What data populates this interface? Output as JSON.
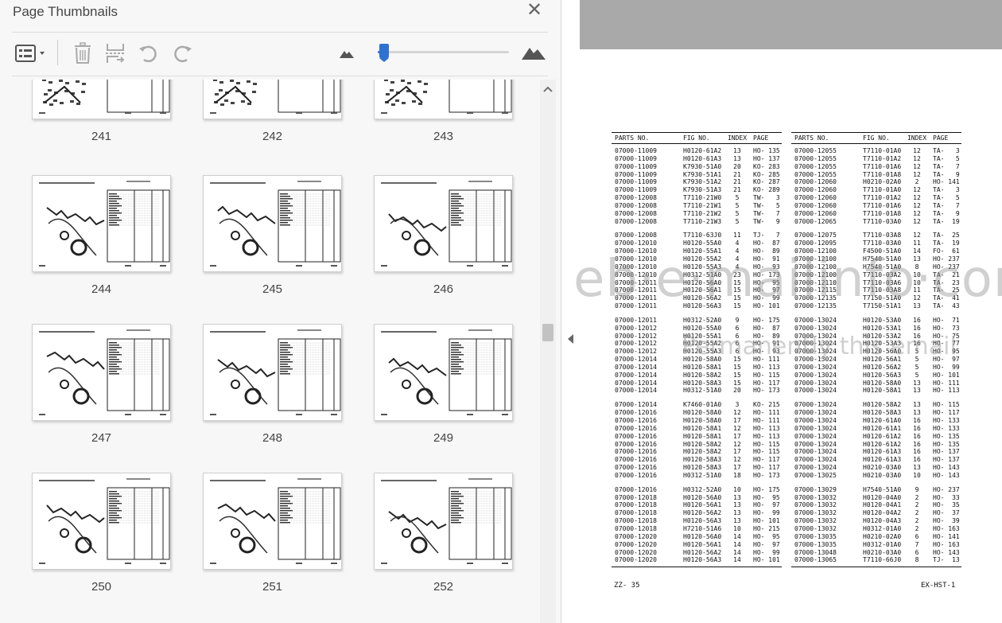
{
  "panel": {
    "title": "Page Thumbnails",
    "close_glyph": "✕",
    "zoom_level": 0.03,
    "toolbar_icons": [
      "options-icon",
      "trash-icon",
      "extract-pages-icon",
      "rotate-ccw-icon",
      "rotate-cw-icon",
      "mountain-small-icon",
      "mountain-large-icon"
    ]
  },
  "thumbnails": [
    {
      "page": "241"
    },
    {
      "page": "242"
    },
    {
      "page": "243"
    },
    {
      "page": "244"
    },
    {
      "page": "245"
    },
    {
      "page": "246"
    },
    {
      "page": "247"
    },
    {
      "page": "248"
    },
    {
      "page": "249"
    },
    {
      "page": "250"
    },
    {
      "page": "251"
    },
    {
      "page": "252"
    }
  ],
  "document": {
    "headers": [
      "PARTS NO.",
      "FIG NO.",
      "INDEX",
      "PAGE"
    ],
    "left_groups": [
      [
        [
          "07000-11009",
          "H0120-61A2",
          "13",
          "HO- 135"
        ],
        [
          "07000-11009",
          "H0120-61A3",
          "13",
          "HO- 137"
        ],
        [
          "07000-11009",
          "K7930-51A0",
          "20",
          "KO- 283"
        ],
        [
          "07000-11009",
          "K7930-51A1",
          "21",
          "KO- 285"
        ],
        [
          "07000-11009",
          "K7930-51A2",
          "21",
          "KO- 287"
        ],
        [
          "07000-11009",
          "K7930-51A3",
          "21",
          "KO- 289"
        ],
        [
          "07000-12008",
          "T7110-21W0",
          "5",
          "TW-   3"
        ],
        [
          "07000-12008",
          "T7110-21W1",
          "5",
          "TW-   5"
        ],
        [
          "07000-12008",
          "T7110-21W2",
          "5",
          "TW-   7"
        ],
        [
          "07000-12008",
          "T7110-21W3",
          "5",
          "TW-   9"
        ]
      ],
      [
        [
          "07000-12008",
          "T7110-63J0",
          "11",
          "TJ-   7"
        ],
        [
          "07000-12010",
          "H0120-55A0",
          "4",
          "HO-  87"
        ],
        [
          "07000-12010",
          "H0120-55A1",
          "4",
          "HO-  89"
        ],
        [
          "07000-12010",
          "H0120-55A2",
          "4",
          "HO-  91"
        ],
        [
          "07000-12010",
          "H0120-55A3",
          "4",
          "HO-  93"
        ],
        [
          "07000-12010",
          "H0312-51A0",
          "23",
          "HO- 173"
        ],
        [
          "07000-12011",
          "H0120-56A0",
          "15",
          "HO-  95"
        ],
        [
          "07000-12011",
          "H0120-56A1",
          "15",
          "HO-  97"
        ],
        [
          "07000-12011",
          "H0120-56A2",
          "15",
          "HO-  99"
        ],
        [
          "07000-12011",
          "H0120-56A3",
          "15",
          "HO- 101"
        ]
      ],
      [
        [
          "07000-12011",
          "H0312-52A0",
          "9",
          "HO- 175"
        ],
        [
          "07000-12012",
          "H0120-55A0",
          "6",
          "HO-  87"
        ],
        [
          "07000-12012",
          "H0120-55A1",
          "6",
          "HO-  89"
        ],
        [
          "07000-12012",
          "H0120-55A2",
          "6",
          "HO-  91"
        ],
        [
          "07000-12012",
          "H0120-55A3",
          "6",
          "HO-  93"
        ],
        [
          "07000-12014",
          "H0120-58A0",
          "15",
          "HO- 111"
        ],
        [
          "07000-12014",
          "H0120-58A1",
          "15",
          "HO- 113"
        ],
        [
          "07000-12014",
          "H0120-58A2",
          "15",
          "HO- 115"
        ],
        [
          "07000-12014",
          "H0120-58A3",
          "15",
          "HO- 117"
        ],
        [
          "07000-12014",
          "H0312-51A0",
          "20",
          "HO- 173"
        ]
      ],
      [
        [
          "07000-12014",
          "K7460-01A0",
          "3",
          "KO- 215"
        ],
        [
          "07000-12016",
          "H0120-58A0",
          "12",
          "HO- 111"
        ],
        [
          "07000-12016",
          "H0120-58A0",
          "17",
          "HO- 111"
        ],
        [
          "07000-12016",
          "H0120-58A1",
          "12",
          "HO- 113"
        ],
        [
          "07000-12016",
          "H0120-58A1",
          "17",
          "HO- 113"
        ],
        [
          "07000-12016",
          "H0120-58A2",
          "12",
          "HO- 115"
        ],
        [
          "07000-12016",
          "H0120-58A2",
          "17",
          "HO- 115"
        ],
        [
          "07000-12016",
          "H0120-58A3",
          "12",
          "HO- 117"
        ],
        [
          "07000-12016",
          "H0120-58A3",
          "17",
          "HO- 117"
        ],
        [
          "07000-12016",
          "H0312-51A0",
          "18",
          "HO- 173"
        ]
      ],
      [
        [
          "07000-12016",
          "H0312-52A0",
          "10",
          "HO- 175"
        ],
        [
          "07000-12018",
          "H0120-56A0",
          "13",
          "HO-  95"
        ],
        [
          "07000-12018",
          "H0120-56A1",
          "13",
          "HO-  97"
        ],
        [
          "07000-12018",
          "H0120-56A2",
          "13",
          "HO-  99"
        ],
        [
          "07000-12018",
          "H0120-56A3",
          "13",
          "HO- 101"
        ],
        [
          "07000-12018",
          "H7210-51A6",
          "10",
          "HO- 215"
        ],
        [
          "07000-12020",
          "H0120-56A0",
          "14",
          "HO-  95"
        ],
        [
          "07000-12020",
          "H0120-56A1",
          "14",
          "HO-  97"
        ],
        [
          "07000-12020",
          "H0120-56A2",
          "14",
          "HO-  99"
        ],
        [
          "07000-12020",
          "H0120-56A3",
          "14",
          "HO- 101"
        ]
      ]
    ],
    "right_groups": [
      [
        [
          "07000-12055",
          "T7110-01A0",
          "12",
          "TA-   3"
        ],
        [
          "07000-12055",
          "T7110-01A2",
          "12",
          "TA-   5"
        ],
        [
          "07000-12055",
          "T7110-01A6",
          "12",
          "TA-   7"
        ],
        [
          "07000-12055",
          "T7110-01A8",
          "12",
          "TA-   9"
        ],
        [
          "07000-12060",
          "H0210-02A0",
          "2",
          "HO- 141"
        ],
        [
          "07000-12060",
          "T7110-01A0",
          "12",
          "TA-   3"
        ],
        [
          "07000-12060",
          "T7110-01A2",
          "12",
          "TA-   5"
        ],
        [
          "07000-12060",
          "T7110-01A6",
          "12",
          "TA-   7"
        ],
        [
          "07000-12060",
          "T7110-01A8",
          "12",
          "TA-   9"
        ],
        [
          "07000-12065",
          "T7110-03A0",
          "12",
          "TA-  19"
        ]
      ],
      [
        [
          "07000-12075",
          "T7110-03A8",
          "12",
          "TA-  25"
        ],
        [
          "07000-12095",
          "T7110-03A0",
          "11",
          "TA-  19"
        ],
        [
          "07000-12100",
          "F4500-51A0",
          "14",
          "FO-  61"
        ],
        [
          "07000-12100",
          "H7540-51A0",
          "13",
          "HO- 237"
        ],
        [
          "07000-12100",
          "H7540-51A0",
          "8",
          "HO- 237"
        ],
        [
          "07000-12100",
          "T7110-03A2",
          "10",
          "TA-  21"
        ],
        [
          "07000-12110",
          "T7110-03A6",
          "10",
          "TA-  23"
        ],
        [
          "07000-12115",
          "T7110-03A8",
          "11",
          "TA-  25"
        ],
        [
          "07000-12135",
          "T7150-51A0",
          "12",
          "TA-  41"
        ],
        [
          "07000-12135",
          "T7150-51A1",
          "13",
          "TA-  43"
        ]
      ],
      [
        [
          "07000-13024",
          "H0120-53A0",
          "16",
          "HO-  71"
        ],
        [
          "07000-13024",
          "H0120-53A1",
          "16",
          "HO-  73"
        ],
        [
          "07000-13024",
          "H0120-53A2",
          "16",
          "HO-  75"
        ],
        [
          "07000-13024",
          "H0120-53A3",
          "16",
          "HO-  77"
        ],
        [
          "07000-13024",
          "H0120-56A0",
          "5",
          "HO-  95"
        ],
        [
          "07000-13024",
          "H0120-56A1",
          "5",
          "HO-  97"
        ],
        [
          "07000-13024",
          "H0120-56A2",
          "5",
          "HO-  99"
        ],
        [
          "07000-13024",
          "H0120-56A3",
          "5",
          "HO- 101"
        ],
        [
          "07000-13024",
          "H0120-58A0",
          "13",
          "HO- 111"
        ],
        [
          "07000-13024",
          "H0120-58A1",
          "13",
          "HO- 113"
        ]
      ],
      [
        [
          "07000-13024",
          "H0120-58A2",
          "13",
          "HO- 115"
        ],
        [
          "07000-13024",
          "H0120-58A3",
          "13",
          "HO- 117"
        ],
        [
          "07000-13024",
          "H0120-61A0",
          "16",
          "HO- 133"
        ],
        [
          "07000-13024",
          "H0120-61A1",
          "16",
          "HO- 133"
        ],
        [
          "07000-13024",
          "H0120-61A2",
          "16",
          "HO- 135"
        ],
        [
          "07000-13024",
          "H0120-61A2",
          "16",
          "HO- 135"
        ],
        [
          "07000-13024",
          "H0120-61A3",
          "16",
          "HO- 137"
        ],
        [
          "07000-13024",
          "H0120-61A3",
          "16",
          "HO- 137"
        ],
        [
          "07000-13024",
          "H0210-03A0",
          "13",
          "HO- 143"
        ],
        [
          "07000-13025",
          "H0210-03A0",
          "10",
          "HO- 143"
        ]
      ],
      [
        [
          "07000-13029",
          "H7540-51A0",
          "9",
          "HO- 237"
        ],
        [
          "07000-13032",
          "H0120-04A0",
          "2",
          "HO-  33"
        ],
        [
          "07000-13032",
          "H0120-04A1",
          "2",
          "HO-  35"
        ],
        [
          "07000-13032",
          "H0120-04A2",
          "2",
          "HO-  37"
        ],
        [
          "07000-13032",
          "H0120-04A3",
          "2",
          "HO-  39"
        ],
        [
          "07000-13032",
          "H0312-01A0",
          "2",
          "HO- 163"
        ],
        [
          "07000-13035",
          "H0210-02A0",
          "6",
          "HO- 141"
        ],
        [
          "07000-13035",
          "H0312-01A0",
          "7",
          "HO- 163"
        ],
        [
          "07000-13048",
          "H0210-03A0",
          "6",
          "HO- 143"
        ],
        [
          "07000-13065",
          "T7110-66J0",
          "8",
          "TJ-  13"
        ]
      ]
    ],
    "footer_left": "ZZ-   35",
    "footer_right": "EX-HST-1",
    "watermark_main": "eb·e·mailinfo·com",
    "watermark_sub": "Permanently this email"
  }
}
